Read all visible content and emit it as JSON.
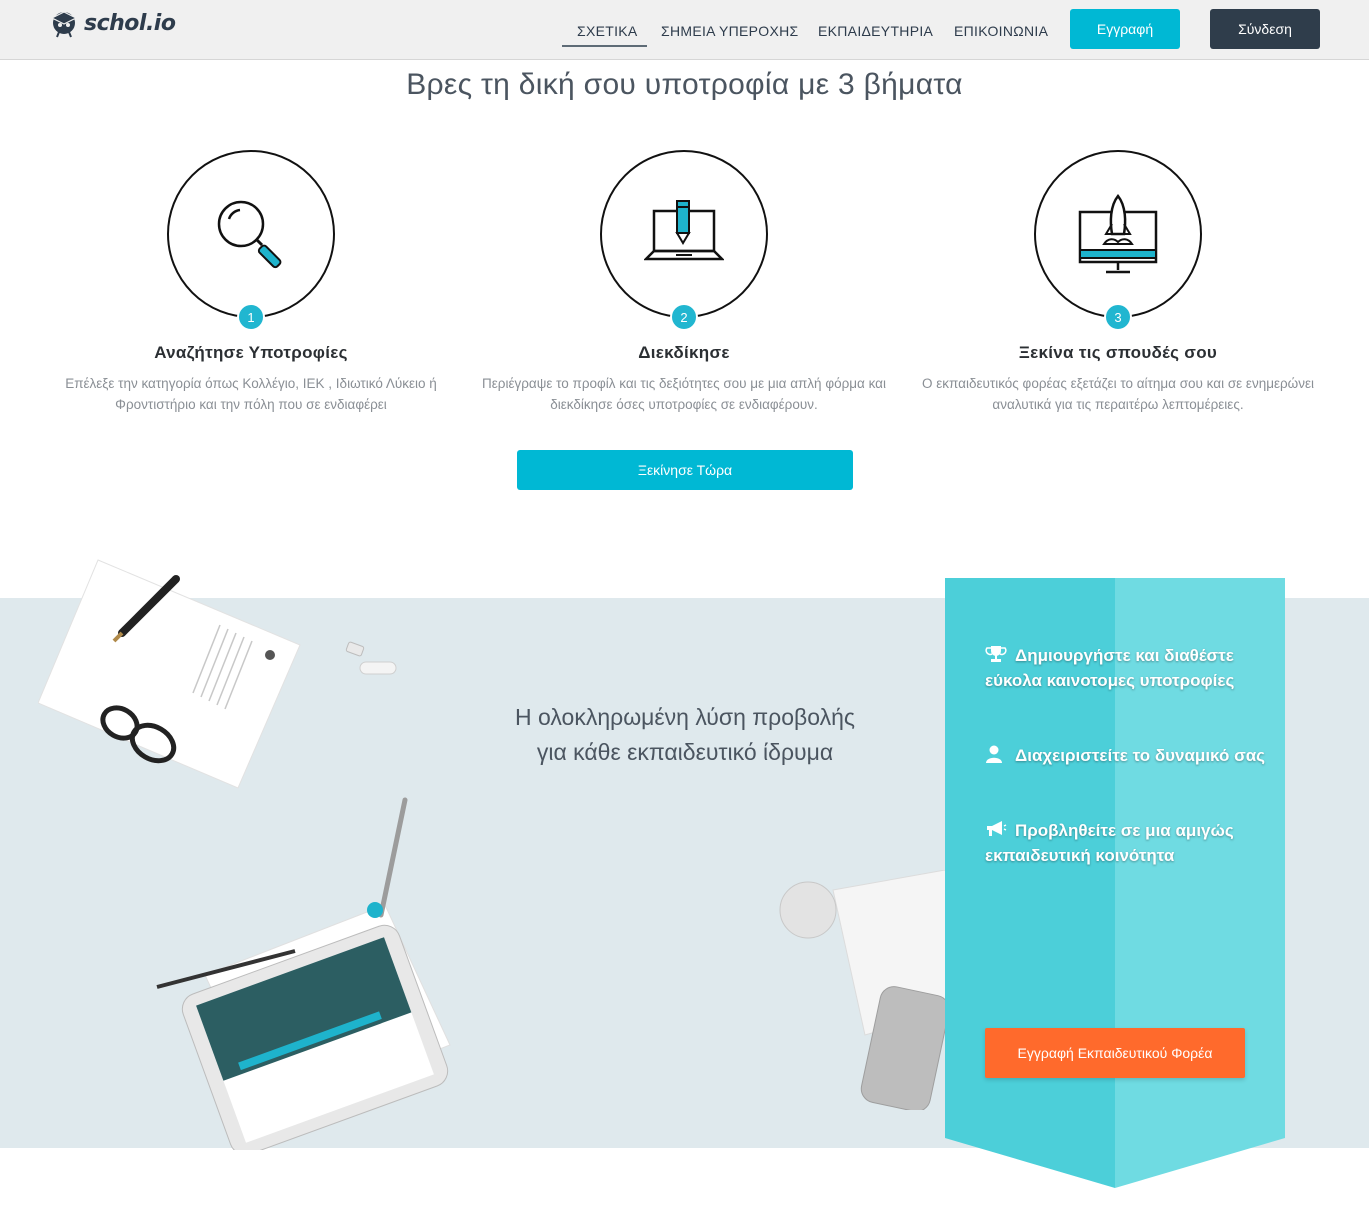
{
  "nav": {
    "brand": "schol.io",
    "links": [
      "ΣΧΕΤΙΚΑ",
      "ΣΗΜΕΙΑ ΥΠΕΡΟΧΗΣ",
      "ΕΚΠΑΙΔΕΥΤΗΡΙΑ",
      "ΕΠΙΚΟΙΝΩΝΙΑ"
    ],
    "active_link": "ΣΧΕΤΙΚΑ",
    "register_label": "Εγγραφή",
    "login_label": "Σύνδεση"
  },
  "steps_section": {
    "title": "Βρες τη δική σου υποτροφία με 3 βήματα",
    "steps": [
      {
        "number": "1",
        "icon": "search-icon",
        "title": "Αναζήτησε Υποτροφίες",
        "description": "Επέλεξε την κατηγορία όπως Κολλέγιο, ΙΕΚ , Ιδιωτικό Λύκειο ή Φροντιστήριο και την πόλη που σε ενδιαφέρει"
      },
      {
        "number": "2",
        "icon": "laptop-pencil-icon",
        "title": "Διεκδίκησε",
        "description": "Περιέγραψε το προφίλ και τις δεξιότητες σου με μια απλή φόρμα και διεκδίκησε όσες υποτροφίες σε ενδιαφέρουν."
      },
      {
        "number": "3",
        "icon": "rocket-monitor-icon",
        "title": "Ξεκίνα τις σπουδές σου",
        "description": "Ο εκπαιδευτικός φορέας εξετάζει το αίτημα σου και σε ενημερώνει αναλυτικά για τις περαιτέρω λεπτομέρειες."
      }
    ],
    "cta_label": "Ξεκίνησε Τώρα"
  },
  "promo_section": {
    "headline_line1": "Η ολοκληρωμένη λύση προβολής",
    "headline_line2": "για κάθε εκπαιδευτικό ίδρυμα",
    "features": [
      {
        "icon": "trophy-icon",
        "text": "Δημιουργήστε και διαθέστε εύκολα καινοτομες υποτροφίες"
      },
      {
        "icon": "user-icon",
        "text": "Διαχειριστείτε το δυναμικό σας"
      },
      {
        "icon": "megaphone-icon",
        "text": "Προβληθείτε σε μια αμιγώς εκπαιδευτική κοινότητα"
      }
    ],
    "cta_label": "Εγγραφή Εκπαιδευτικού Φορέα"
  },
  "colors": {
    "accent": "#00b8d4",
    "dark": "#2f3d4b",
    "orange": "#ff6a2c",
    "ribbon_dark": "#4ccfd9",
    "ribbon_light": "#6fdbe2",
    "band": "#dfe9ed"
  }
}
